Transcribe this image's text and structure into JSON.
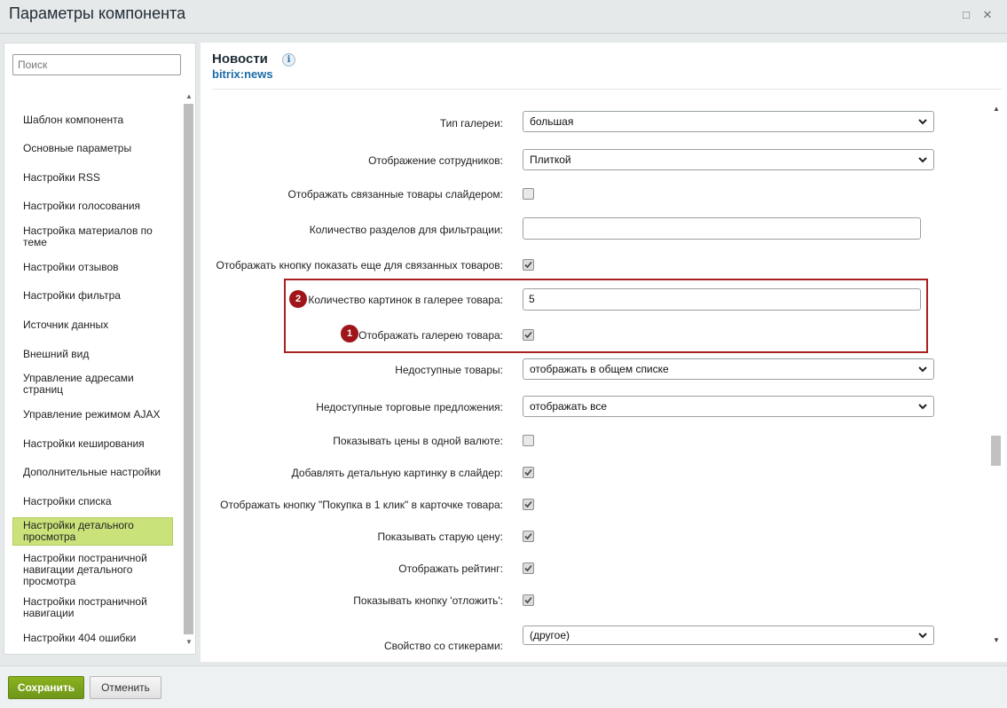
{
  "window": {
    "title": "Параметры компонента",
    "restore_symbol": "□",
    "close_symbol": "✕"
  },
  "sidebar": {
    "search_placeholder": "Поиск",
    "items": [
      {
        "label": "Шаблон компонента"
      },
      {
        "label": "Основные параметры"
      },
      {
        "label": "Настройки RSS"
      },
      {
        "label": "Настройки голосования"
      },
      {
        "label": "Настройка материалов по теме"
      },
      {
        "label": "Настройки отзывов"
      },
      {
        "label": "Настройки фильтра"
      },
      {
        "label": "Источник данных"
      },
      {
        "label": "Внешний вид"
      },
      {
        "label": "Управление адресами страниц"
      },
      {
        "label": "Управление режимом AJAX"
      },
      {
        "label": "Настройки кеширования"
      },
      {
        "label": "Дополнительные настройки"
      },
      {
        "label": "Настройки списка"
      },
      {
        "label": "Настройки детального просмотра",
        "active": true
      },
      {
        "label": "Настройки постраничной навигации детального просмотра"
      },
      {
        "label": "Настройки постраничной навигации"
      },
      {
        "label": "Настройки 404 ошибки"
      }
    ]
  },
  "component": {
    "title": "Новости",
    "info_icon": "info-icon",
    "code": "bitrix:news"
  },
  "params": {
    "gallery_type": {
      "label": "Тип галереи:",
      "value": "большая"
    },
    "staff_display": {
      "label": "Отображение сотрудников:",
      "value": "Плиткой"
    },
    "related_slider": {
      "label": "Отображать связанные товары слайдером:",
      "checked": false
    },
    "filter_sections": {
      "label": "Количество разделов для фильтрации:",
      "value": ""
    },
    "show_more_related": {
      "label": "Отображать кнопку показать еще для связанных товаров:",
      "checked": true
    },
    "gallery_images_count": {
      "label": "Количество картинок в галерее товара:",
      "value": "5",
      "badge": "2"
    },
    "show_gallery": {
      "label": "Отображать галерею товара:",
      "checked": true,
      "badge": "1"
    },
    "unavailable_products": {
      "label": "Недоступные товары:",
      "value": "отображать в общем списке"
    },
    "unavailable_offers": {
      "label": "Недоступные торговые предложения:",
      "value": "отображать все"
    },
    "one_currency": {
      "label": "Показывать цены в одной валюте:",
      "checked": false
    },
    "detail_picture_slider": {
      "label": "Добавлять детальную картинку в слайдер:",
      "checked": true
    },
    "one_click": {
      "label": "Отображать кнопку \"Покупка в 1 клик\" в карточке товара:",
      "checked": true
    },
    "old_price": {
      "label": "Показывать старую цену:",
      "checked": true
    },
    "rating": {
      "label": "Отображать рейтинг:",
      "checked": true
    },
    "delay_button": {
      "label": "Показывать кнопку 'отложить':",
      "checked": true
    },
    "sticker_property": {
      "label": "Свойство со стикерами:",
      "value": "(другое)"
    }
  },
  "footer": {
    "save_label": "Сохранить",
    "cancel_label": "Отменить"
  },
  "colors": {
    "active_item": "#c9e27a",
    "highlight_border": "#a8201f",
    "badge": "#a0151a",
    "save_button": "#7ba11c",
    "component_code": "#1c6ba8"
  }
}
